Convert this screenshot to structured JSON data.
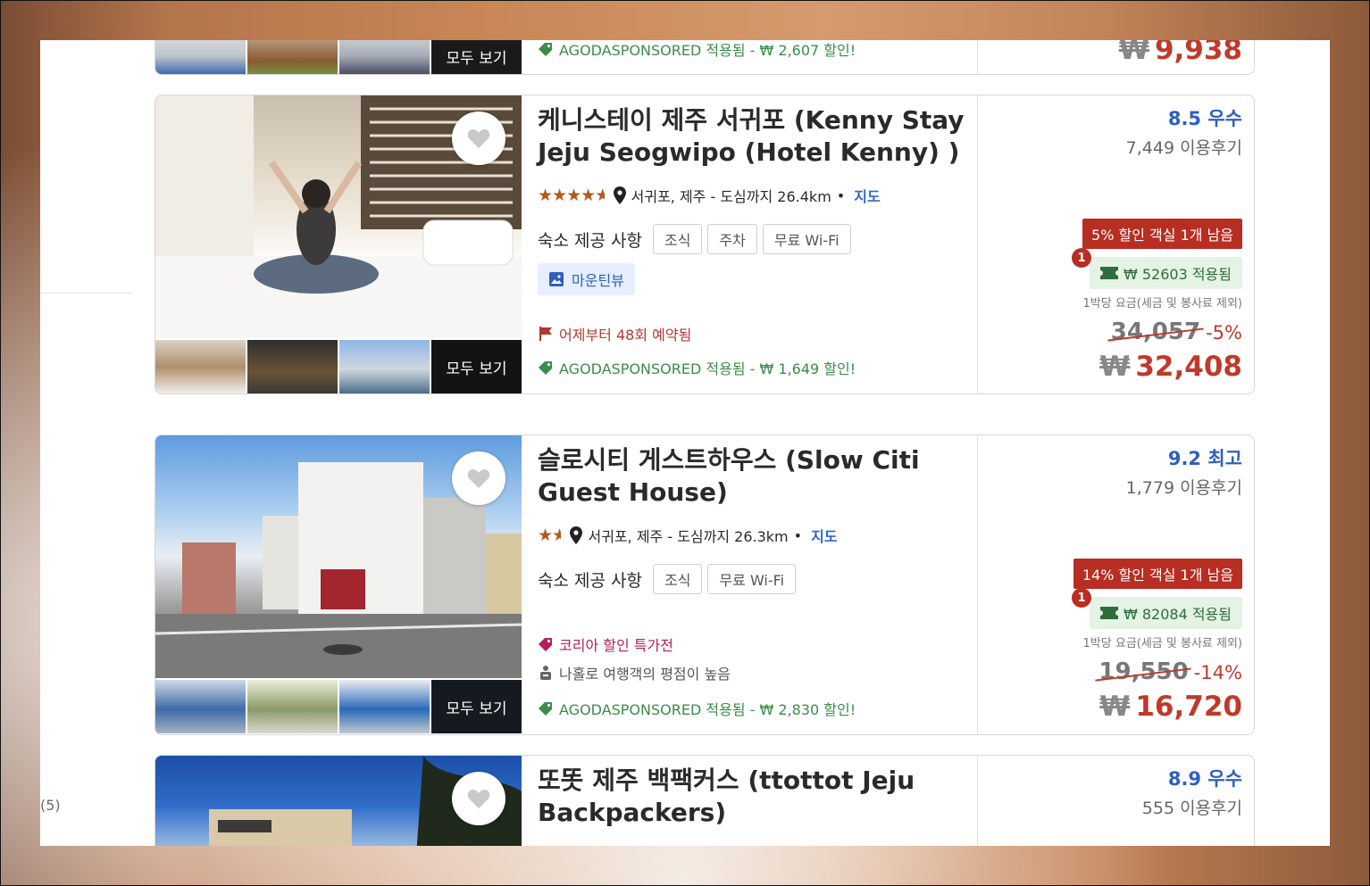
{
  "colors": {
    "accent_blue": "#2f5fbf",
    "price_red": "#c0392b",
    "deal_red": "#b82e22",
    "coupon_green": "#2f6e3c",
    "star_orange": "#b35a1d"
  },
  "sidebar": {
    "count": "(5)"
  },
  "common": {
    "see_all": "모두 보기",
    "amen_label": "숙소 제공 사항",
    "map": "지도",
    "per_night": "1박당 요금(세금 및 봉사료 제외)",
    "won": "₩",
    "coupon_badge": "1"
  },
  "cards": [
    {
      "sponsor": "AGODASPONSORED 적용됨 - ₩ 2,607 할인!",
      "final_price": "9,938"
    },
    {
      "title": "케니스테이 제주 서귀포 (Kenny Stay Jeju Seogwipo (Hotel Kenny) )",
      "stars": "★★★★",
      "star_rating": 4.5,
      "location": "서귀포, 제주 - 도심까지 26.4km",
      "amenities": [
        "조식",
        "주차",
        "무료 Wi-Fi"
      ],
      "mountain_view": "마운틴뷰",
      "booked": "어제부터 48회 예약됨",
      "sponsor": "AGODASPONSORED 적용됨 - ₩ 1,649 할인!",
      "score": "8.5 우수",
      "reviews": "7,449 이용후기",
      "deal": "5% 할인 객실 1개 남음",
      "coupon": "₩ 52603 적용됨",
      "orig_price": "34,057",
      "discount": "-5%",
      "final_price": "32,408"
    },
    {
      "title": "슬로시티 게스트하우스 (Slow Citi Guest House)",
      "stars": "★★",
      "star_rating": 1.5,
      "location": "서귀포, 제주 - 도심까지 26.3km",
      "amenities": [
        "조식",
        "무료 Wi-Fi"
      ],
      "promo": "코리아 할인 특가전",
      "solo": "나홀로 여행객의 평점이 높음",
      "sponsor": "AGODASPONSORED 적용됨 - ₩ 2,830 할인!",
      "score": "9.2 최고",
      "reviews": "1,779 이용후기",
      "deal": "14% 할인 객실 1개 남음",
      "coupon": "₩ 82084 적용됨",
      "orig_price": "19,550",
      "discount": "-14%",
      "final_price": "16,720"
    },
    {
      "title": "또똣 제주 백팩커스 (ttottot Jeju Backpackers)",
      "score": "8.9 우수",
      "reviews": "555 이용후기"
    }
  ]
}
